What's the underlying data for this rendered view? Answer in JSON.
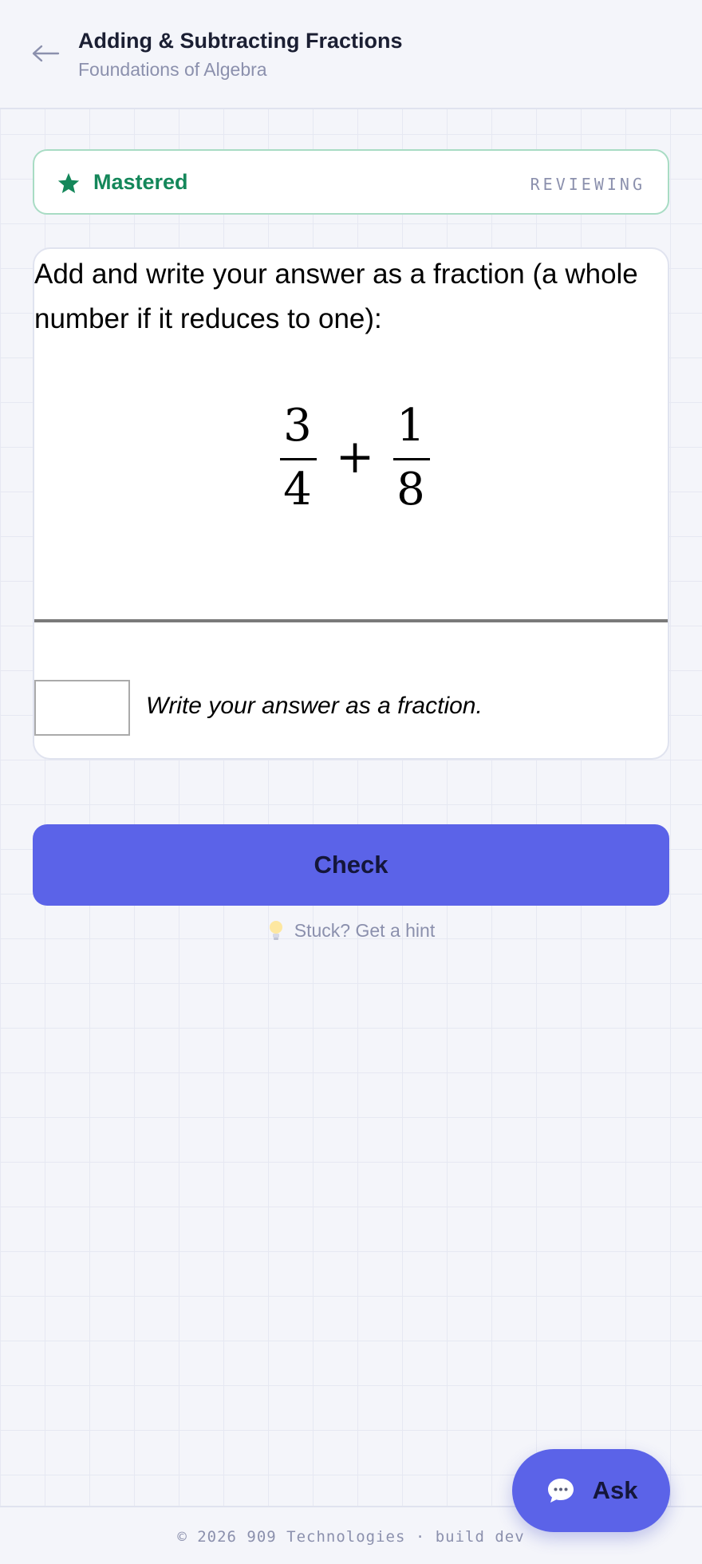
{
  "header": {
    "back_icon": "arrow-left-icon",
    "title": "Adding & Subtracting Fractions",
    "subtitle": "Foundations of Algebra"
  },
  "status": {
    "icon": "star-icon",
    "label": "Mastered",
    "state": "REVIEWING",
    "colors": {
      "accent": "#14875a",
      "border": "#a8dcc4"
    }
  },
  "question": {
    "prompt": "Add and write your answer as a fraction (a whole number if it reduces to one):",
    "expression": {
      "left": {
        "numerator": "3",
        "denominator": "4"
      },
      "operator": "+",
      "right": {
        "numerator": "1",
        "denominator": "8"
      }
    },
    "answer": {
      "value": "",
      "hint": "Write your answer as a fraction."
    }
  },
  "actions": {
    "check_label": "Check",
    "hint_icon": "lightbulb-icon",
    "hint_label": "Stuck? Get a hint",
    "ask_icon": "chat-bubble-icon",
    "ask_label": "Ask"
  },
  "footer": {
    "text": "© 2026 909 Technologies · build dev"
  },
  "theme": {
    "primary": "#5b63e8",
    "background": "#f4f5fa",
    "muted_text": "#8b90ad"
  }
}
